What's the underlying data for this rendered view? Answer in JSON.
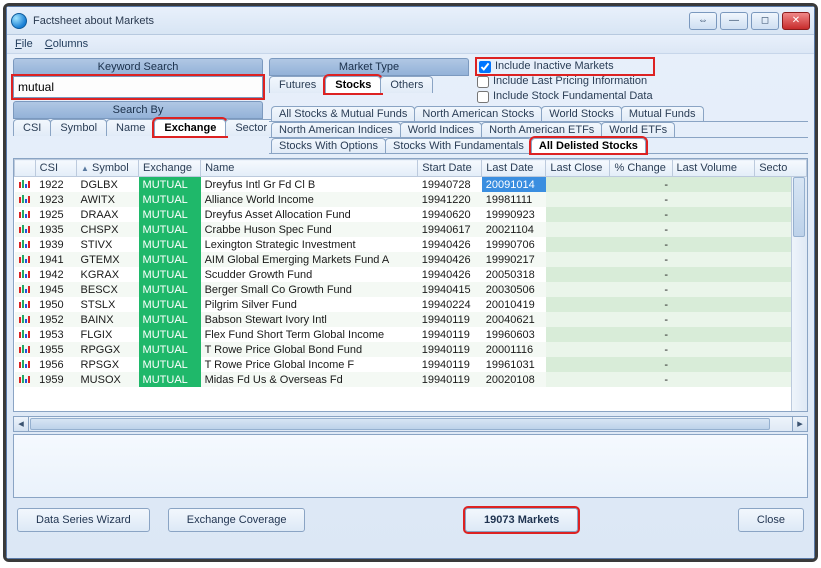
{
  "window": {
    "title": "Factsheet about Markets"
  },
  "menu": {
    "file": "File",
    "columns": "Columns"
  },
  "search": {
    "keyword_label": "Keyword Search",
    "value": "mutual",
    "searchby_label": "Search By",
    "tabs": [
      "CSI",
      "Symbol",
      "Name",
      "Exchange",
      "Sector"
    ],
    "active_tab": "Exchange"
  },
  "market_type": {
    "label": "Market Type",
    "tabs": [
      "Futures",
      "Stocks",
      "Others"
    ],
    "active_tab": "Stocks"
  },
  "includes": {
    "inactive": {
      "label": "Include Inactive Markets",
      "checked": true
    },
    "last_pricing": {
      "label": "Include Last Pricing Information",
      "checked": false
    },
    "fundamental": {
      "label": "Include Stock Fundamental Data",
      "checked": false
    }
  },
  "subtabs_row1": [
    "All Stocks & Mutual Funds",
    "North American Stocks",
    "World Stocks",
    "Mutual Funds"
  ],
  "subtabs_row2": [
    "North American Indices",
    "World Indices",
    "North American ETFs",
    "World ETFs"
  ],
  "subtabs_row3": [
    "Stocks With Options",
    "Stocks With Fundamentals",
    "All Delisted Stocks"
  ],
  "subtabs_active": "All Delisted Stocks",
  "columns": [
    "",
    "CSI",
    "Symbol",
    "Exchange",
    "Name",
    "Start Date",
    "Last Date",
    "Last Close",
    "% Change",
    "Last Volume",
    "Secto"
  ],
  "rows": [
    {
      "csi": "1922",
      "sym": "DGLBX",
      "exch": "MUTUAL",
      "name": "Dreyfus Intl Gr Fd Cl B",
      "sd": "19940728",
      "ld": "20091014",
      "sel": true
    },
    {
      "csi": "1923",
      "sym": "AWITX",
      "exch": "MUTUAL",
      "name": "Alliance World Income",
      "sd": "19941220",
      "ld": "19981111"
    },
    {
      "csi": "1925",
      "sym": "DRAAX",
      "exch": "MUTUAL",
      "name": "Dreyfus Asset Allocation Fund",
      "sd": "19940620",
      "ld": "19990923"
    },
    {
      "csi": "1935",
      "sym": "CHSPX",
      "exch": "MUTUAL",
      "name": "Crabbe Huson Spec Fund",
      "sd": "19940617",
      "ld": "20021104"
    },
    {
      "csi": "1939",
      "sym": "STIVX",
      "exch": "MUTUAL",
      "name": "Lexington Strategic Investment",
      "sd": "19940426",
      "ld": "19990706"
    },
    {
      "csi": "1941",
      "sym": "GTEMX",
      "exch": "MUTUAL",
      "name": "AIM Global Emerging Markets Fund A",
      "sd": "19940426",
      "ld": "19990217"
    },
    {
      "csi": "1942",
      "sym": "KGRAX",
      "exch": "MUTUAL",
      "name": "Scudder Growth Fund",
      "sd": "19940426",
      "ld": "20050318"
    },
    {
      "csi": "1945",
      "sym": "BESCX",
      "exch": "MUTUAL",
      "name": "Berger Small Co Growth Fund",
      "sd": "19940415",
      "ld": "20030506"
    },
    {
      "csi": "1950",
      "sym": "STSLX",
      "exch": "MUTUAL",
      "name": "Pilgrim Silver Fund",
      "sd": "19940224",
      "ld": "20010419"
    },
    {
      "csi": "1952",
      "sym": "BAINX",
      "exch": "MUTUAL",
      "name": "Babson Stewart Ivory Intl",
      "sd": "19940119",
      "ld": "20040621"
    },
    {
      "csi": "1953",
      "sym": "FLGIX",
      "exch": "MUTUAL",
      "name": "Flex Fund Short Term Global Income",
      "sd": "19940119",
      "ld": "19960603"
    },
    {
      "csi": "1955",
      "sym": "RPGGX",
      "exch": "MUTUAL",
      "name": "T Rowe Price Global Bond Fund",
      "sd": "19940119",
      "ld": "20001116"
    },
    {
      "csi": "1956",
      "sym": "RPSGX",
      "exch": "MUTUAL",
      "name": "T Rowe Price Global Income F",
      "sd": "19940119",
      "ld": "19961031"
    },
    {
      "csi": "1959",
      "sym": "MUSOX",
      "exch": "MUTUAL",
      "name": "Midas Fd Us & Overseas Fd",
      "sd": "19940119",
      "ld": "20020108"
    }
  ],
  "buttons": {
    "wizard": "Data Series Wizard",
    "coverage": "Exchange Coverage",
    "count": "19073 Markets",
    "close": "Close"
  }
}
